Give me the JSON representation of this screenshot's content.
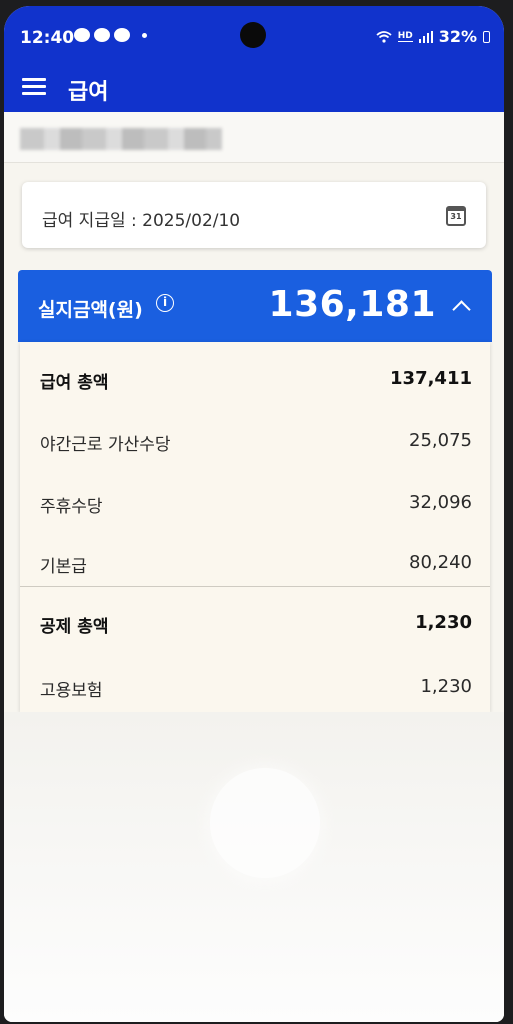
{
  "status_bar": {
    "time": "12:40",
    "network_label": "HD",
    "battery": "32%"
  },
  "app_bar": {
    "title": "급여"
  },
  "pay_date": {
    "label": "급여 지급일 : 2025/02/10",
    "calendar_day": "31"
  },
  "net_pay": {
    "label": "실지금액(원)",
    "amount": "136,181"
  },
  "details": [
    {
      "label": "급여 총액",
      "value": "137,411"
    },
    {
      "label": "야간근로 가산수당",
      "value": "25,075"
    },
    {
      "label": "주휴수당",
      "value": "32,096"
    },
    {
      "label": "기본급",
      "value": "80,240"
    },
    {
      "label": "공제 총액",
      "value": "1,230"
    },
    {
      "label": "고용보험",
      "value": "1,230"
    }
  ],
  "colors": {
    "header_blue": "#1133cc",
    "net_pay_blue": "#1a5fe0"
  }
}
